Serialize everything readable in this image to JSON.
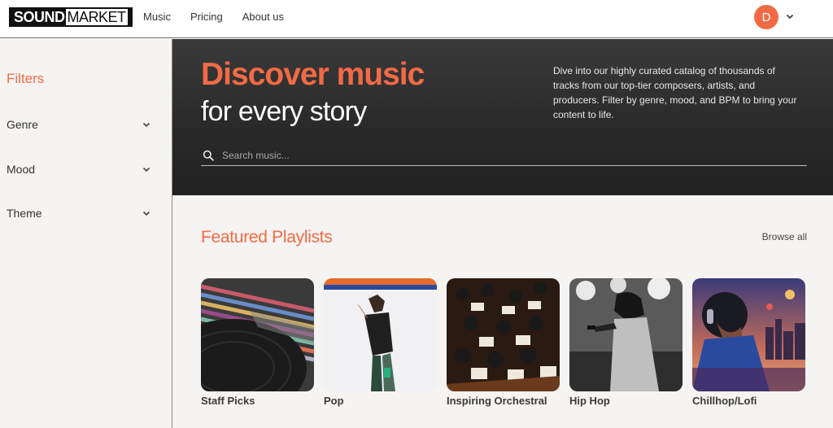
{
  "brand": {
    "logo_bold": "SOUND",
    "logo_light": "MARKET"
  },
  "nav": {
    "items": [
      {
        "label": "Music"
      },
      {
        "label": "Pricing"
      },
      {
        "label": "About us"
      }
    ]
  },
  "user": {
    "avatar_initial": "D"
  },
  "sidebar": {
    "title": "Filters",
    "filters": [
      {
        "label": "Genre"
      },
      {
        "label": "Mood"
      },
      {
        "label": "Theme"
      }
    ]
  },
  "hero": {
    "title": "Discover music",
    "subtitle": "for every story",
    "description": "Dive into our highly curated catalog of thousands of tracks from our top-tier composers, artists, and producers. Filter by genre, mood, and BPM to bring your content to life.",
    "search_placeholder": "Search music..."
  },
  "featured": {
    "title": "Featured Playlists",
    "browse_label": "Browse all",
    "playlists": [
      {
        "label": "Staff Picks"
      },
      {
        "label": "Pop"
      },
      {
        "label": "Inspiring Orchestral"
      },
      {
        "label": "Hip Hop"
      },
      {
        "label": "Chillhop/Lofi"
      }
    ]
  },
  "colors": {
    "accent": "#f26a45",
    "hero_bg": "#2a2a2a",
    "sidebar_bg": "#f6f4f2"
  }
}
